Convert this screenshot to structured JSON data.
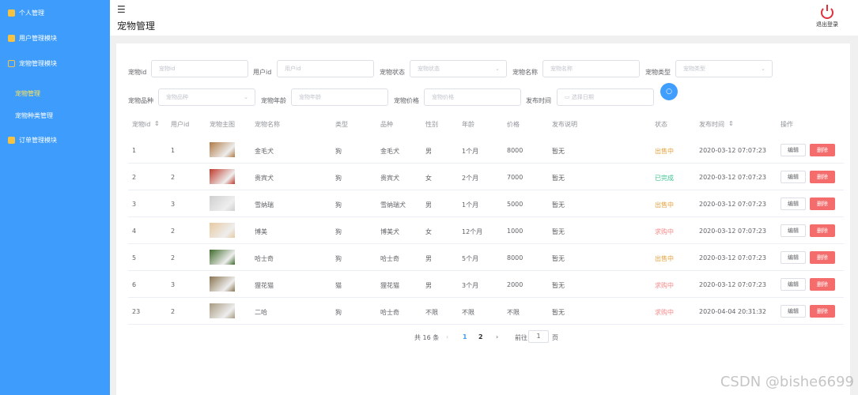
{
  "sidebar": {
    "items": [
      {
        "label": "个人管理",
        "icon": "user-icon"
      },
      {
        "label": "用户管理模块",
        "icon": "user-icon"
      },
      {
        "label": "宠物管理模块",
        "icon": "bag-icon",
        "children": [
          {
            "label": "宠物管理",
            "active": true
          },
          {
            "label": "宠物种类管理"
          }
        ]
      },
      {
        "label": "订单管理模块",
        "icon": "document-icon"
      }
    ]
  },
  "header": {
    "menu_icon": "☰",
    "title": "宠物管理",
    "logout": "退出登录"
  },
  "filters": [
    {
      "label": "宠物id",
      "placeholder": "宠物id"
    },
    {
      "label": "用户id",
      "placeholder": "用户id"
    },
    {
      "label": "宠物状态",
      "placeholder": "宠物状态"
    },
    {
      "label": "宠物名称",
      "placeholder": "宠物名称"
    },
    {
      "label": "宠物类型",
      "placeholder": "宠物类型"
    },
    {
      "label": "宠物品种",
      "placeholder": "宠物品种"
    },
    {
      "label": "宠物年龄",
      "placeholder": "宠物年龄"
    },
    {
      "label": "宠物价格",
      "placeholder": "宠物价格"
    },
    {
      "label": "发布时间",
      "placeholder": "选择日期"
    }
  ],
  "table": {
    "columns": [
      "宠物id",
      "用户id",
      "宠物主图",
      "宠物名称",
      "类型",
      "品种",
      "性别",
      "年龄",
      "价格",
      "发布说明",
      "状态",
      "发布时间",
      "操作"
    ],
    "edit_label": "编辑",
    "delete_label": "删除",
    "rows": [
      {
        "id": "1",
        "uid": "1",
        "name": "金毛犬",
        "type": "狗",
        "breed": "金毛犬",
        "sex": "男",
        "age": "1个月",
        "price": "8000",
        "desc": "暂无",
        "status": "出售中",
        "time": "2020-03-12 07:07:23"
      },
      {
        "id": "2",
        "uid": "2",
        "name": "贵宾犬",
        "type": "狗",
        "breed": "贵宾犬",
        "sex": "女",
        "age": "2个月",
        "price": "7000",
        "desc": "暂无",
        "status": "已完成",
        "time": "2020-03-12 07:07:23"
      },
      {
        "id": "3",
        "uid": "3",
        "name": "雪纳瑞",
        "type": "狗",
        "breed": "雪纳瑞犬",
        "sex": "男",
        "age": "1个月",
        "price": "5000",
        "desc": "暂无",
        "status": "出售中",
        "time": "2020-03-12 07:07:23"
      },
      {
        "id": "4",
        "uid": "2",
        "name": "博美",
        "type": "狗",
        "breed": "博美犬",
        "sex": "女",
        "age": "12个月",
        "price": "1000",
        "desc": "暂无",
        "status": "求购中",
        "time": "2020-03-12 07:07:23"
      },
      {
        "id": "5",
        "uid": "2",
        "name": "哈士奇",
        "type": "狗",
        "breed": "哈士奇",
        "sex": "男",
        "age": "5个月",
        "price": "8000",
        "desc": "暂无",
        "status": "出售中",
        "time": "2020-03-12 07:07:23"
      },
      {
        "id": "6",
        "uid": "3",
        "name": "狸花猫",
        "type": "猫",
        "breed": "狸花猫",
        "sex": "男",
        "age": "3个月",
        "price": "2000",
        "desc": "暂无",
        "status": "求购中",
        "time": "2020-03-12 07:07:23"
      },
      {
        "id": "23",
        "uid": "2",
        "name": "二哈",
        "type": "狗",
        "breed": "哈士奇",
        "sex": "不限",
        "age": "不限",
        "price": "不限",
        "desc": "暂无",
        "status": "求购中",
        "time": "2020-04-04 20:31:32"
      }
    ]
  },
  "status_colors": {
    "出售中": "#e6a23c",
    "已完成": "#3cc78f",
    "求购中": "#f78989"
  },
  "thumb_colors": [
    "#b07a45",
    "#c0392b",
    "#cfcfcf",
    "#e8c9a0",
    "#3f6b2a",
    "#8a7550",
    "#a89a80"
  ],
  "pagination": {
    "total": "共 16 条",
    "prev": "‹",
    "pages": [
      "1",
      "2"
    ],
    "current": "1",
    "next": "›",
    "goto": "前往",
    "goto_value": "1",
    "page_unit": "页"
  },
  "watermark": "CSDN @bishe6699"
}
